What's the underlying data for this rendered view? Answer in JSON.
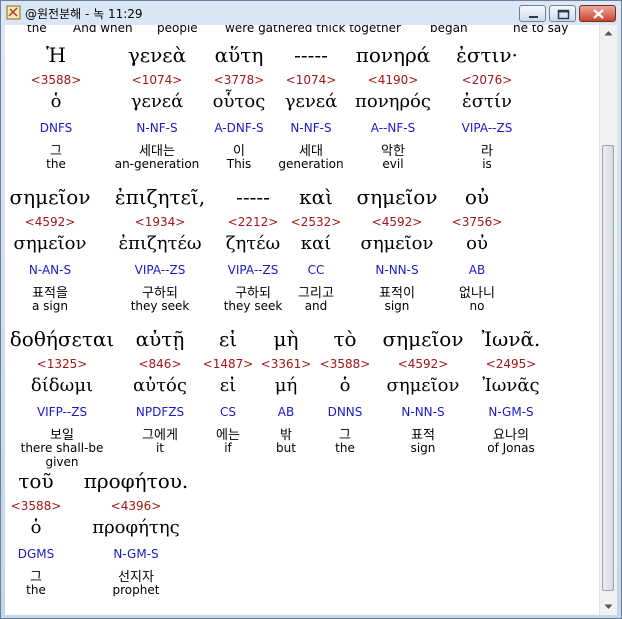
{
  "window": {
    "title": "@원전분해 - 녹 11:29"
  },
  "cut_line": [
    "the",
    "And when",
    "people",
    "were gathered thick together",
    "began",
    "he to say"
  ],
  "rows": [
    {
      "words": [
        {
          "greek": "Ἡ",
          "strong": "<3588>",
          "lemma": "ὁ",
          "parse": "DNFS",
          "korean": "그",
          "english": "the"
        },
        {
          "greek": "γενεὰ",
          "strong": "<1074>",
          "lemma": "γενεά",
          "parse": "N-NF-S",
          "korean": "세대는",
          "english": "an-generation"
        },
        {
          "greek": "αὕτη",
          "strong": "<3778>",
          "lemma": "οὗτος",
          "parse": "A-DNF-S",
          "korean": "이",
          "english": "This"
        },
        {
          "greek": "-----",
          "strong": "<1074>",
          "lemma": "γενεά",
          "parse": "N-NF-S",
          "korean": "세대",
          "english": "generation"
        },
        {
          "greek": "πονηρά",
          "strong": "<4190>",
          "lemma": "πονηρός",
          "parse": "A--NF-S",
          "korean": "악한",
          "english": "evil"
        },
        {
          "greek": "ἐστιν·",
          "strong": "<2076>",
          "lemma": "ἐστίν",
          "parse": "VIPA--ZS",
          "korean": "라",
          "english": "is"
        }
      ]
    },
    {
      "words": [
        {
          "greek": "σημεῖον",
          "strong": "<4592>",
          "lemma": "σημεῖον",
          "parse": "N-AN-S",
          "korean": "표적을",
          "english": "a sign"
        },
        {
          "greek": "ἐπιζητεῖ,",
          "strong": "<1934>",
          "lemma": "ἐπιζητέω",
          "parse": "VIPA--ZS",
          "korean": "구하되",
          "english": "they seek"
        },
        {
          "greek": "-----",
          "strong": "<2212>",
          "lemma": "ζητέω",
          "parse": "VIPA--ZS",
          "korean": "구하되",
          "english": "they seek"
        },
        {
          "greek": "καὶ",
          "strong": "<2532>",
          "lemma": "καί",
          "parse": "CC",
          "korean": "그리고",
          "english": "and"
        },
        {
          "greek": "σημεῖον",
          "strong": "<4592>",
          "lemma": "σημεῖον",
          "parse": "N-NN-S",
          "korean": "표적이",
          "english": "sign"
        },
        {
          "greek": "οὐ",
          "strong": "<3756>",
          "lemma": "οὐ",
          "parse": "AB",
          "korean": "없나니",
          "english": "no"
        }
      ]
    },
    {
      "words": [
        {
          "greek": "δοθήσεται",
          "strong": "<1325>",
          "lemma": "δίδωμι",
          "parse": "VIFP--ZS",
          "korean": "보일",
          "english": "there shall-be given"
        },
        {
          "greek": "αὐτῇ",
          "strong": "<846>",
          "lemma": "αὐτός",
          "parse": "NPDFZS",
          "korean": "그에게",
          "english": "it"
        },
        {
          "greek": "εἰ",
          "strong": "<1487>",
          "lemma": "εἰ",
          "parse": "CS",
          "korean": "에는",
          "english": "if"
        },
        {
          "greek": "μὴ",
          "strong": "<3361>",
          "lemma": "μή",
          "parse": "AB",
          "korean": "밖",
          "english": "but"
        },
        {
          "greek": "τὸ",
          "strong": "<3588>",
          "lemma": "ὁ",
          "parse": "DNNS",
          "korean": "그",
          "english": "the"
        },
        {
          "greek": "σημεῖον",
          "strong": "<4592>",
          "lemma": "σημεῖον",
          "parse": "N-NN-S",
          "korean": "표적",
          "english": "sign"
        },
        {
          "greek": "Ἰωνᾶ.",
          "strong": "<2495>",
          "lemma": "Ἰωνᾶς",
          "parse": "N-GM-S",
          "korean": "요나의",
          "english": "of Jonas"
        }
      ]
    },
    {
      "words": [
        {
          "greek": "τοῦ",
          "strong": "<3588>",
          "lemma": "ὁ",
          "parse": "DGMS",
          "korean": "그",
          "english": "the"
        },
        {
          "greek": "προφήτου.",
          "strong": "<4396>",
          "lemma": "προφήτης",
          "parse": "N-GM-S",
          "korean": "선지자",
          "english": "prophet"
        }
      ]
    }
  ]
}
